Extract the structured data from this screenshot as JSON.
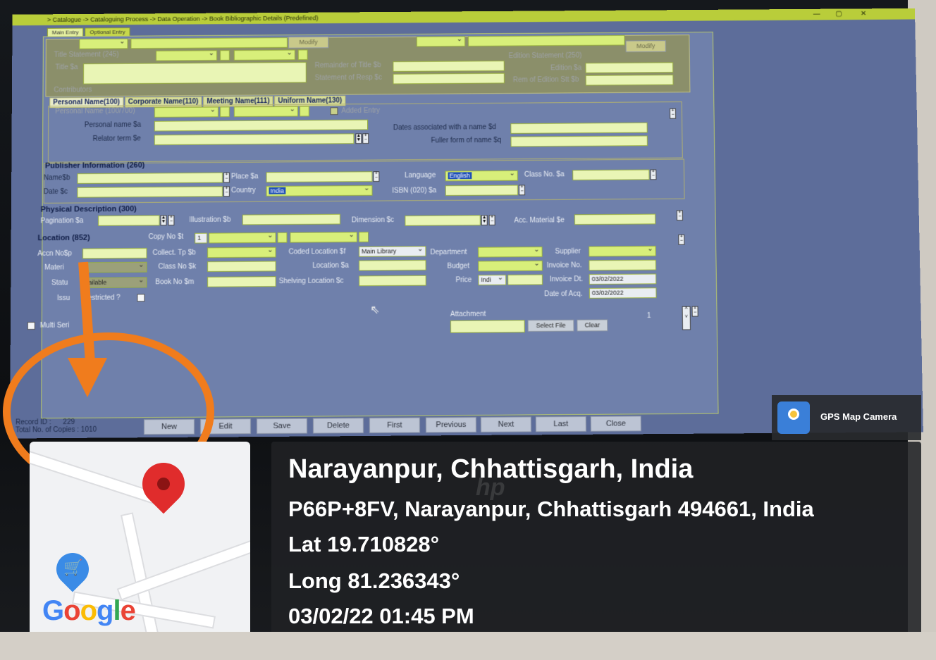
{
  "window": {
    "breadcrumb": "> Catalogue -> Cataloguing Process -> Data Operation -> Book Bibliographic Details (Predefined)",
    "controls": [
      "—",
      "▢",
      "✕"
    ]
  },
  "tabs": [
    "Main Entry",
    "Optional Entry"
  ],
  "top_section": {
    "modify_label": "Modify",
    "modify2_label": "Modify",
    "title_statement": "Title Statement (245)",
    "title_label": "Title $a",
    "remainder_label": "Remainder of Title $b",
    "statement_label": "Statement of Resp $c",
    "edition_statement": "Edition Statement (250)",
    "edition_label": "Edition $a",
    "rem_edition_label": "Rem of Edition Stt $b",
    "contributors": "Contributors"
  },
  "name_tabs": [
    "Personal Name(100)",
    "Corporate Name(110)",
    "Meeting Name(111)",
    "Uniform Name(130)"
  ],
  "personal_name": {
    "header": "Personal Name (100/700)",
    "added_entry": "Added Entry",
    "name_label": "Personal name $a",
    "relator_label": "Relator term $e",
    "dates_label": "Dates associated with a name $d",
    "fuller_label": "Fuller form of name $q"
  },
  "publisher": {
    "header": "Publisher Information (260)",
    "name_label": "Name$b",
    "place_label": "Place $a",
    "language_label": "Language",
    "language_value": "English",
    "classno_label": "Class No. $a",
    "date_label": "Date $c",
    "country_label": "Country",
    "country_value": "India",
    "isbn_label": "ISBN (020) $a"
  },
  "physical": {
    "header": "Physical Description (300)",
    "pagination_label": "Pagination $a",
    "illustration_label": "Illustration $b",
    "dimension_label": "Dimension $c",
    "acc_label": "Acc. Material $e"
  },
  "location": {
    "header": "Location (852)",
    "copyno_label": "Copy No $t",
    "copyno_value": "1",
    "accn_label": "Accn No$p",
    "collect_label": "Collect. Tp $b",
    "coded_label": "Coded Location $f",
    "coded_value": "Main Library",
    "department_label": "Department",
    "supplier_label": "Supplier",
    "material_label": "Materi",
    "classno_label": "Class No $k",
    "location_label": "Location $a",
    "budget_label": "Budget",
    "invoice_label": "Invoice No.",
    "status_label": "Statu",
    "status_value": "vailable",
    "bookno_label": "Book No $m",
    "shelving_label": "Shelving Location $c",
    "price_label": "Price",
    "price_currency": "Indi",
    "invoice_dt_label": "Invoice Dt.",
    "invoice_dt_value": "03/02/2022",
    "issue_label": "Issu",
    "restricted_label": "estricted ?",
    "date_acq_label": "Date of Acq.",
    "date_acq_value": "03/02/2022",
    "attachment_label": "Attachment",
    "select_file": "Select File",
    "clear": "Clear",
    "attachment_count": "1",
    "multi_series": "Multi Seri"
  },
  "status": {
    "record_id_label": "Record ID :",
    "record_id_value": "229",
    "total_copies": "Total No. of Copies : 1010"
  },
  "nav_buttons": [
    "New",
    "Edit",
    "Save",
    "Delete",
    "First",
    "Previous",
    "Next",
    "Last",
    "Close"
  ],
  "gps": {
    "app_name": "GPS Map Camera",
    "place": "Narayanpur, Chhattisgarh, India",
    "address": "P66P+8FV, Narayanpur, Chhattisgarh 494661, India",
    "lat": "Lat 19.710828°",
    "long": "Long 81.236343°",
    "datetime": "03/02/22 01:45 PM",
    "map_brand": "Google",
    "monitor_brand": "hp"
  },
  "colors": {
    "annotation": "#f07c1d",
    "field": "#d8ef7a",
    "panel": "#6f80ab"
  }
}
